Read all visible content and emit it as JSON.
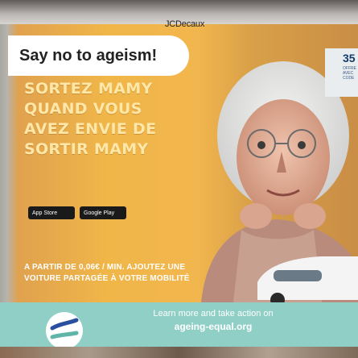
{
  "colors": {
    "poster_yellow": "#f0b648",
    "footer_teal": "#8fcfc6",
    "logo_blue": "#2a4fa0"
  },
  "brand": "JCDecaux",
  "banner": "Say no to ageism!",
  "poster": {
    "headline": [
      "SORTEZ MAMY",
      "QUAND VOUS",
      "AVEZ ENVIE DE",
      "SORTIR MAMY"
    ],
    "store_buttons": [
      "App Store",
      "Google Play"
    ],
    "price_lines": [
      "A PARTIR DE 0,06€ / MIN. AJOUTEZ UNE",
      "VOITURE PARTAGÉE À VOTRE MOBILITÉ"
    ],
    "price_badge": "35",
    "price_badge_small": [
      "OFFRE",
      "AVEC",
      "CODE"
    ]
  },
  "footer": {
    "line1": "Learn more and take action on",
    "line2": "ageing-equal.org",
    "logo_icon": "ageing-equal-logo-icon"
  }
}
